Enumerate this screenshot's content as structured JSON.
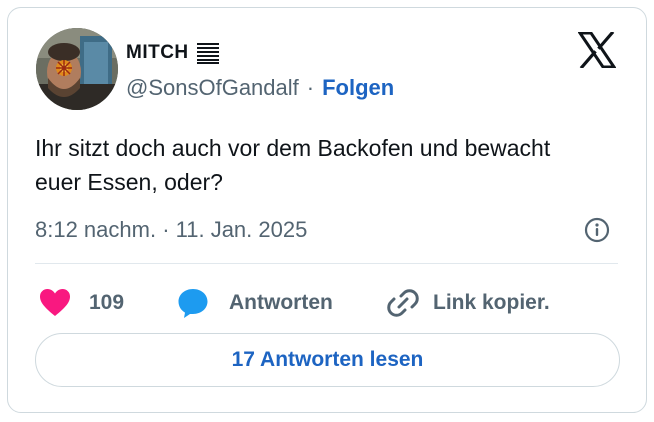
{
  "author": {
    "display_name": "MITCH",
    "handle": "@SonsOfGandalf",
    "separator": "·",
    "follow_label": "Folgen"
  },
  "tweet": {
    "text": "Ihr sitzt doch auch vor dem Backofen und bewacht euer Essen, oder?",
    "timestamp": "8:12 nachm. · 11. Jan. 2025"
  },
  "actions": {
    "like_count": "109",
    "reply_label": "Antworten",
    "copy_label": "Link kopier."
  },
  "read_replies_label": "17 Antworten lesen",
  "colors": {
    "accent": "#1d64c2",
    "like": "#f91880",
    "reply": "#1d9bf0",
    "secondary_text": "#536471",
    "border": "#cfd9de"
  },
  "icons": {
    "name_badge": "lines-icon",
    "brand": "x-logo-icon",
    "info": "info-icon",
    "like": "heart-icon",
    "reply": "speech-bubble-icon",
    "copy": "link-icon"
  }
}
